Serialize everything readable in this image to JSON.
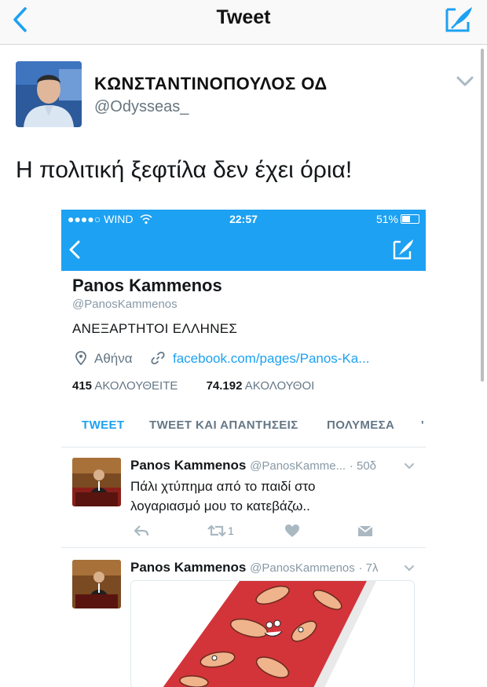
{
  "nav": {
    "title": "Tweet"
  },
  "tweet": {
    "author_name": "ΚΩΝΣΤΑΝΤΙΝΟΠΟΥΛΟΣ ΟΔ",
    "author_handle": "@Odysseas_",
    "text": "Η πολιτική ξεφτίλα δεν έχει όρια!"
  },
  "embedded": {
    "status_bar": {
      "carrier": "●●●●○ WIND",
      "time": "22:57",
      "battery": "51%",
      "battery_level": 0.51
    },
    "profile": {
      "name": "Panos Kammenos",
      "handle": "@PanosKammenos",
      "bio": "ΑΝΕΞΑΡΤΗΤΟΙ ΕΛΛΗΝΕΣ",
      "location": "Αθήνα",
      "link": "facebook.com/pages/Panos-Ka...",
      "following_count": "415",
      "following_label": "ΑΚΟΛΟΥΘΕΙΤΕ",
      "followers_count": "74.192",
      "followers_label": "ΑΚΟΛΟΥΘΟΙ"
    },
    "tabs": [
      "TWEET",
      "TWEET ΚΑΙ ΑΠΑΝΤΗΣΕΙΣ",
      "ΠΟΛΥΜΕΣΑ",
      "'"
    ],
    "tweets": [
      {
        "name": "Panos Kammenos",
        "handle": "@PanosKamme...",
        "time": "· 50δ",
        "text": "Πάλι χτύπημα από το παιδί στο λογαριασμό μου το κατεβάζω..",
        "retweets": "1"
      },
      {
        "name": "Panos Kammenos",
        "handle": "@PanosKammenos",
        "time": "· 7λ"
      }
    ]
  },
  "colors": {
    "twitter_blue": "#1da1f2",
    "text": "#14171a",
    "secondary": "#657786"
  }
}
